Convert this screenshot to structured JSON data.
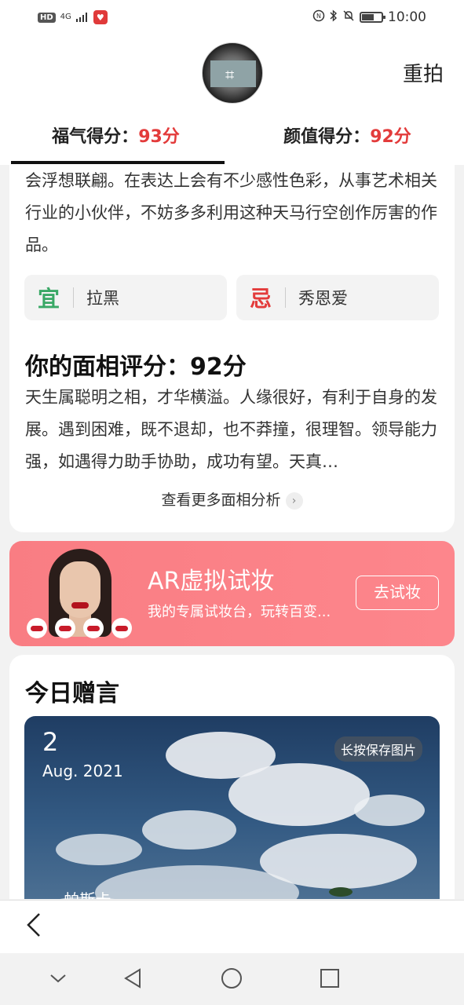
{
  "status_bar": {
    "hd": "HD",
    "network": "4G",
    "time": "10:00"
  },
  "header": {
    "retake_label": "重拍"
  },
  "tabs": [
    {
      "label": "福气得分：",
      "score": "93分"
    },
    {
      "label": "颜值得分：",
      "score": "92分"
    }
  ],
  "analysis": {
    "intro_cut_line": "……………………………………………",
    "intro_text": "会浮想联翩。在表达上会有不少感性色彩，从事艺术相关行业的小伙伴，不妨多多利用这种天马行空创作厉害的作品。",
    "good_symbol": "宜",
    "good_value": "拉黑",
    "bad_symbol": "忌",
    "bad_value": "秀恩爱",
    "face_score_title": "你的面相评分：92分",
    "face_text": "天生属聪明之相，才华横溢。人缘很好，有利于自身的发展。遇到困难，既不退却，也不莽撞，很理智。领导能力强，如遇得力助手协助，成功有望。天真…",
    "more_link": "查看更多面相分析"
  },
  "ar_banner": {
    "title": "AR虚拟试妆",
    "subtitle": "我的专属试妆台，玩转百变...",
    "button": "去试妆"
  },
  "gift": {
    "title": "今日赠言",
    "day": "2",
    "month": "Aug. 2021",
    "save_hint": "长按保存图片",
    "author": "— 帕斯卡"
  },
  "colors": {
    "accent_red": "#e33b3b",
    "good_green": "#3aa866",
    "banner_pink": "#fd868c"
  }
}
